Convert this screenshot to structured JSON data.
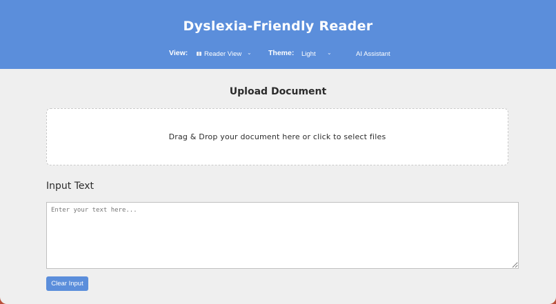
{
  "header": {
    "title": "Dyslexia-Friendly Reader",
    "view_label": "View:",
    "view_selected": "Reader View",
    "view_icon": "book-icon",
    "theme_label": "Theme:",
    "theme_selected": "Light",
    "ai_button": "AI Assistant",
    "background_color": "#5b8edb"
  },
  "upload": {
    "title": "Upload Document",
    "dropzone_text": "Drag & Drop your document here or click to select files"
  },
  "input": {
    "title": "Input Text",
    "placeholder": "Enter your text here...",
    "value": "",
    "clear_button": "Clear Input"
  },
  "colors": {
    "accent": "#5b8edb",
    "page_background": "#efefef"
  }
}
